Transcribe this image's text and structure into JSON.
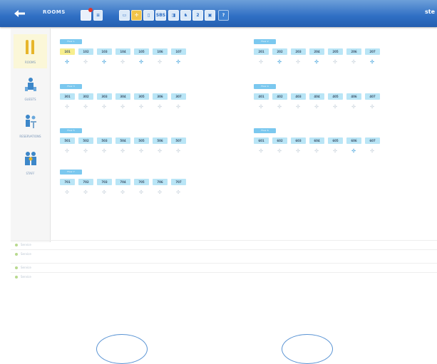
{
  "header": {
    "title": "ROOMS",
    "user": "ste",
    "toolbar": [
      {
        "name": "alert-tool",
        "label": "",
        "icon": "alert-icon"
      },
      {
        "name": "list-tool",
        "label": "≡",
        "icon": "list-icon"
      },
      {
        "name": "card-tool",
        "label": "▭",
        "icon": "card-icon"
      },
      {
        "name": "fan-tool",
        "label": "✣",
        "icon": "fan-icon"
      },
      {
        "name": "door-tool",
        "label": "▯",
        "icon": "door-icon"
      },
      {
        "name": "sbs-tool",
        "label": "SBS",
        "icon": "sbs-icon"
      },
      {
        "name": "thermo-tool",
        "label": "◨",
        "icon": "thermostat-icon"
      },
      {
        "name": "person-tool",
        "label": "♞",
        "icon": "person-icon"
      },
      {
        "name": "number-tool",
        "label": "2",
        "icon": "number-icon"
      },
      {
        "name": "display-tool",
        "label": "▣",
        "icon": "display-icon"
      },
      {
        "name": "help-tool",
        "label": "?",
        "icon": "help-icon"
      }
    ]
  },
  "sidebar": {
    "items": [
      {
        "label": "ROOMS",
        "icon": "rooms-icon"
      },
      {
        "label": "GUESTS",
        "icon": "guests-icon"
      },
      {
        "label": "RESERVATIONS",
        "icon": "reservations-icon"
      },
      {
        "label": "STAFF",
        "icon": "staff-icon"
      }
    ]
  },
  "floors": [
    {
      "label": "Floor 1",
      "rooms": [
        "101",
        "102",
        "103",
        "104",
        "105",
        "106",
        "107"
      ],
      "occupied": [
        "101"
      ],
      "on": [
        "101",
        "103",
        "105",
        "107"
      ]
    },
    {
      "label": "Floor 2",
      "rooms": [
        "201",
        "202",
        "203",
        "204",
        "205",
        "206",
        "207"
      ],
      "occupied": [],
      "on": [
        "202",
        "204",
        "207"
      ]
    },
    {
      "label": "Floor 3",
      "rooms": [
        "301",
        "302",
        "303",
        "304",
        "305",
        "306",
        "307"
      ],
      "occupied": [],
      "on": []
    },
    {
      "label": "Floor 4",
      "rooms": [
        "401",
        "402",
        "403",
        "404",
        "405",
        "406",
        "407"
      ],
      "occupied": [],
      "on": []
    },
    {
      "label": "Floor 5",
      "rooms": [
        "501",
        "502",
        "503",
        "504",
        "505",
        "506",
        "507"
      ],
      "occupied": [],
      "on": []
    },
    {
      "label": "Floor 6",
      "rooms": [
        "601",
        "602",
        "603",
        "604",
        "605",
        "606",
        "607"
      ],
      "occupied": [],
      "on": [
        "606"
      ]
    },
    {
      "label": "Floor 7",
      "rooms": [
        "701",
        "702",
        "703",
        "704",
        "705",
        "706",
        "707"
      ],
      "occupied": [],
      "on": []
    }
  ],
  "lower": {
    "rows": [
      "Service",
      "Service",
      "Service",
      "Service"
    ]
  }
}
